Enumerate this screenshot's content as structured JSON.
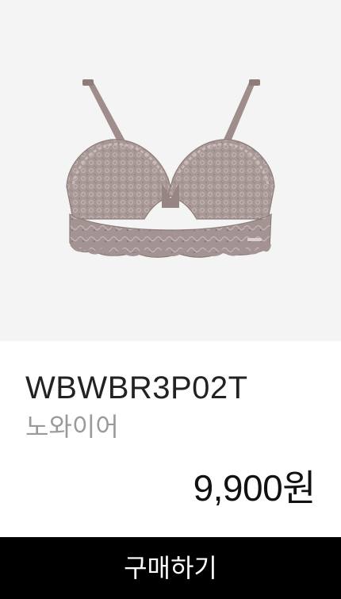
{
  "product": {
    "image_alt": "lace bralette in mauve taupe",
    "code": "WBWBR3P02T",
    "brand": "노와이어",
    "price": "9,900원",
    "color": "#9c8a88"
  },
  "actions": {
    "buy_label": "구매하기"
  },
  "colors": {
    "image_background": "#f4f4f4",
    "button_background": "#000000",
    "button_text": "#ffffff",
    "brand_text": "#9a9a9a"
  }
}
